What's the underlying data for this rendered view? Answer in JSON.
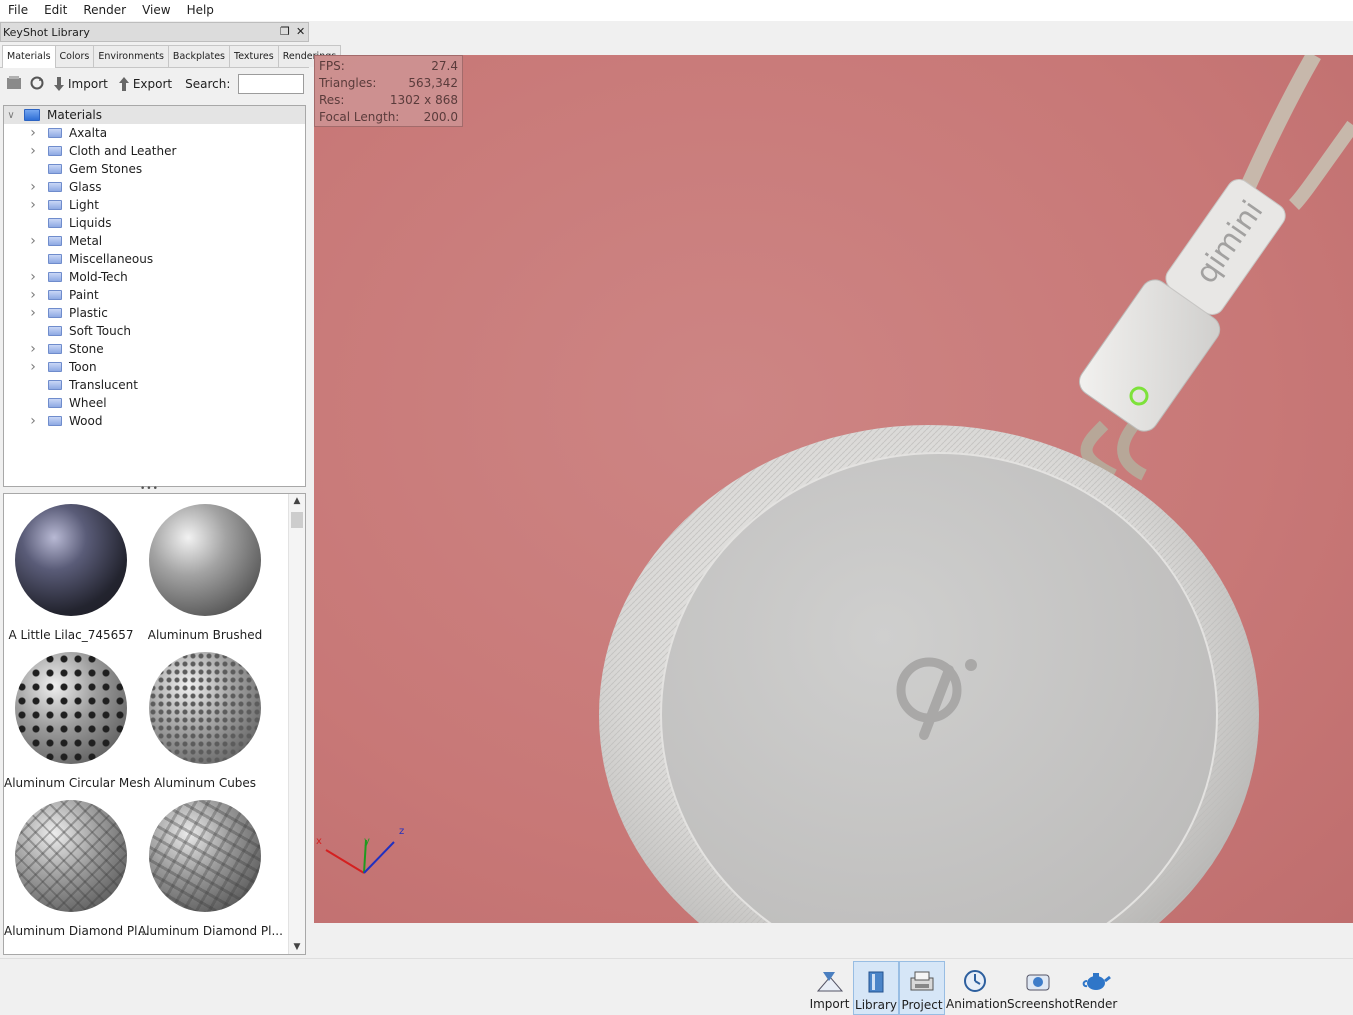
{
  "menu": [
    "File",
    "Edit",
    "Render",
    "View",
    "Help"
  ],
  "panel": {
    "title": "KeyShot Library",
    "tabs": [
      "Materials",
      "Colors",
      "Environments",
      "Backplates",
      "Textures",
      "Renderings"
    ],
    "active_tab": "Materials",
    "toolbar": {
      "import_label": "Import",
      "export_label": "Export",
      "search_label": "Search:",
      "search_value": ""
    }
  },
  "tree": {
    "root": "Materials",
    "items": [
      {
        "label": "Axalta",
        "expandable": true
      },
      {
        "label": "Cloth and Leather",
        "expandable": true
      },
      {
        "label": "Gem Stones",
        "expandable": false
      },
      {
        "label": "Glass",
        "expandable": true
      },
      {
        "label": "Light",
        "expandable": true
      },
      {
        "label": "Liquids",
        "expandable": false
      },
      {
        "label": "Metal",
        "expandable": true
      },
      {
        "label": "Miscellaneous",
        "expandable": false
      },
      {
        "label": "Mold-Tech",
        "expandable": true
      },
      {
        "label": "Paint",
        "expandable": true
      },
      {
        "label": "Plastic",
        "expandable": true
      },
      {
        "label": "Soft Touch",
        "expandable": false
      },
      {
        "label": "Stone",
        "expandable": true
      },
      {
        "label": "Toon",
        "expandable": true
      },
      {
        "label": "Translucent",
        "expandable": false
      },
      {
        "label": "Wheel",
        "expandable": false
      },
      {
        "label": "Wood",
        "expandable": true
      }
    ]
  },
  "materials": [
    "A Little Lilac_745657",
    "Aluminum Brushed",
    "Aluminum Circular Mesh",
    "Aluminum Cubes",
    "Aluminum Diamond Pl...",
    "Aluminum Diamond Pl..."
  ],
  "hud": [
    {
      "label": "FPS:",
      "value": "27.4"
    },
    {
      "label": "Triangles:",
      "value": "563,342"
    },
    {
      "label": "Res:",
      "value": "1302 x 868"
    },
    {
      "label": "Focal Length:",
      "value": "200.0"
    }
  ],
  "viewport": {
    "brand_text": "qimini",
    "axis_labels": [
      "x",
      "y",
      "z"
    ],
    "background": "#c87877"
  },
  "bottom_bar": [
    "Import",
    "Library",
    "Project",
    "Animation",
    "Screenshot",
    "Render"
  ]
}
